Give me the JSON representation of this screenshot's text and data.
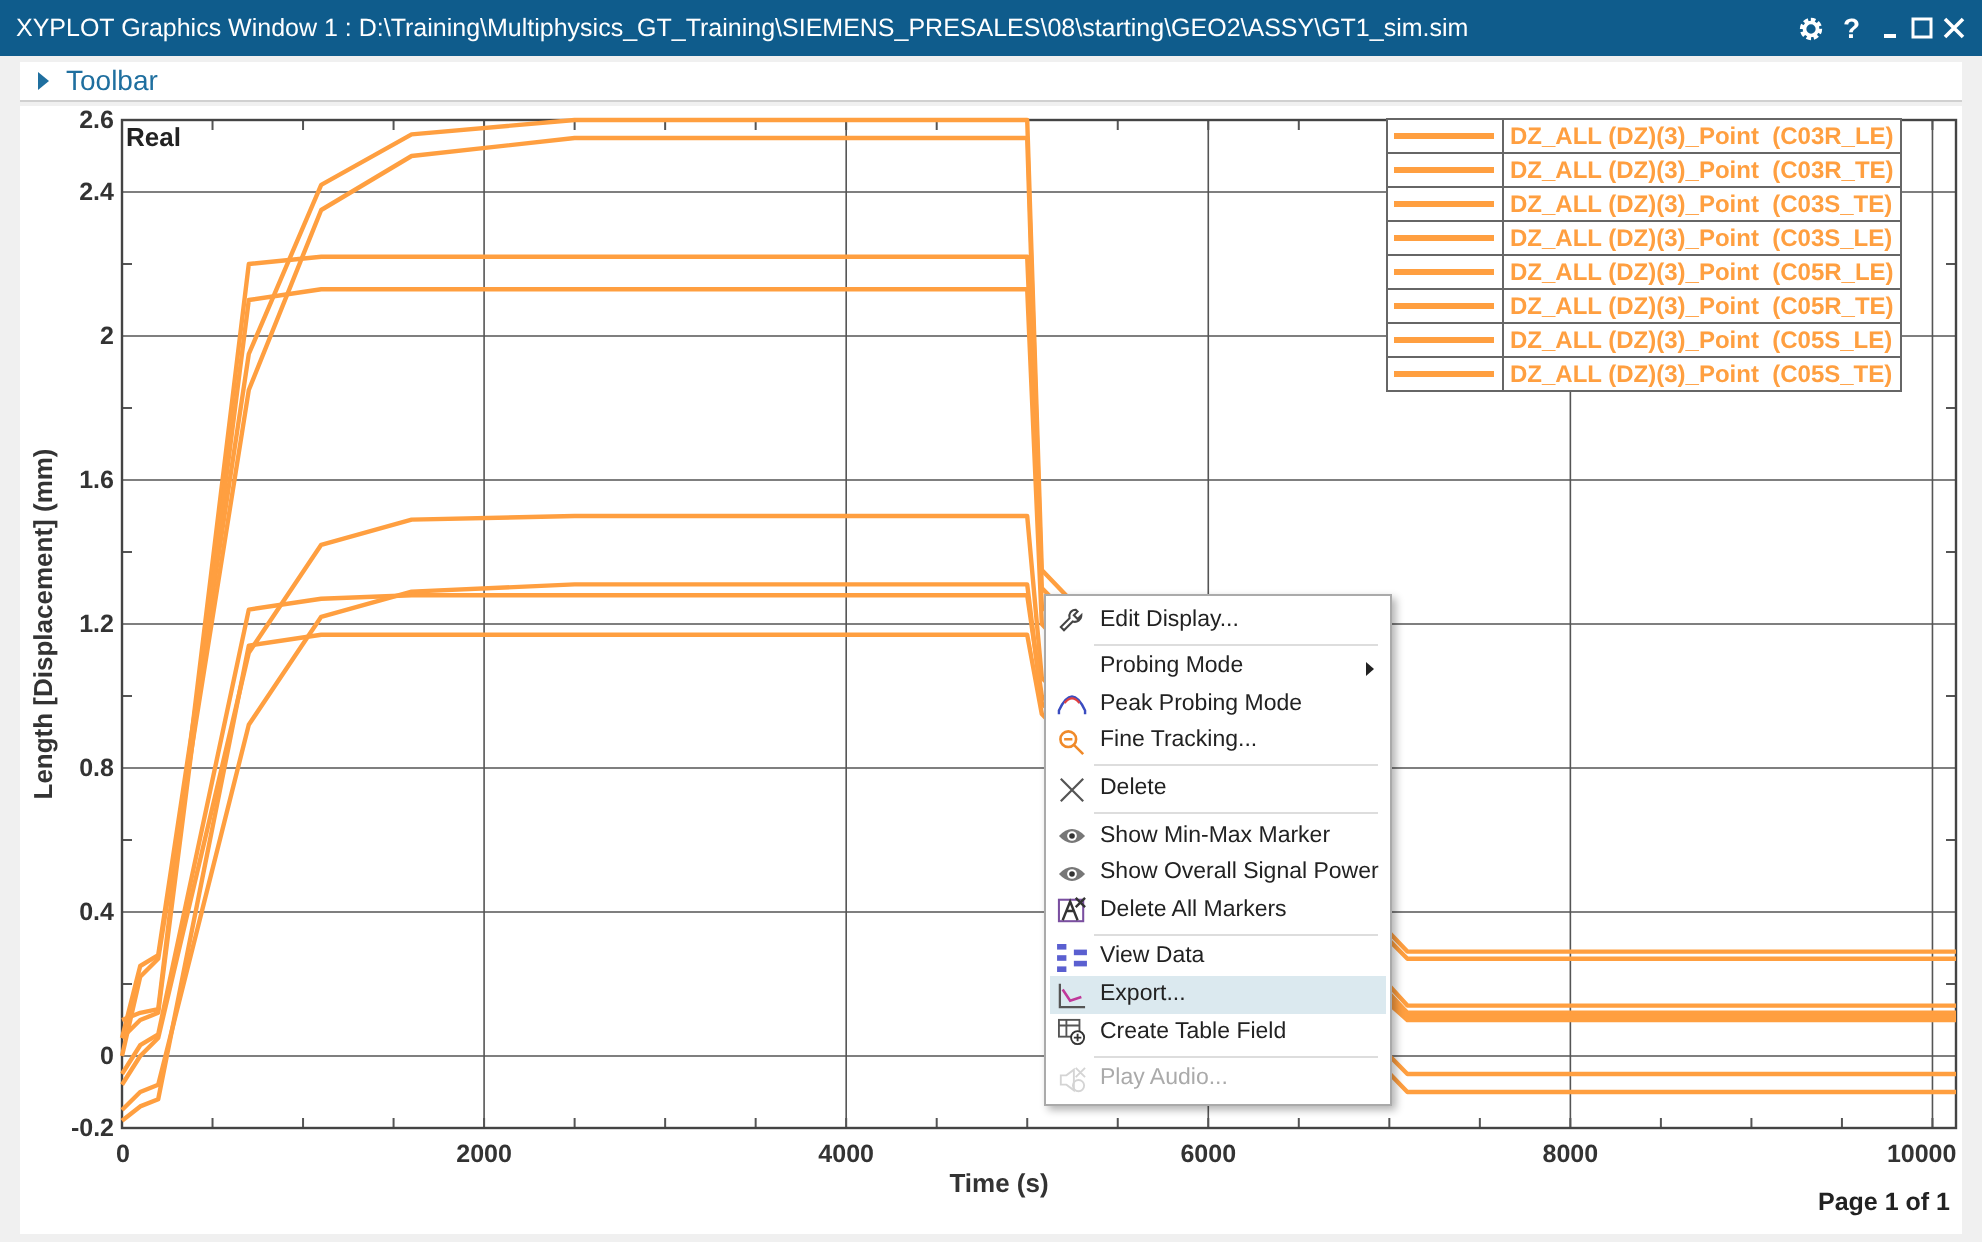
{
  "window": {
    "title": "XYPLOT Graphics Window 1 : D:\\Training\\Multiphysics_GT_Training\\SIEMENS_PRESALES\\08\\starting\\GEO2\\ASSY\\GT1_sim.sim",
    "help": "?"
  },
  "toolbar": {
    "label": "Toolbar",
    "expanded": false
  },
  "plot": {
    "corner_label": "Real",
    "page": "Page 1 of 1",
    "chart_data": {
      "type": "line",
      "xlabel": "Time (s)",
      "ylabel": "Length [Displacement] (mm)",
      "grid": true,
      "x": [
        0,
        100,
        200,
        700,
        1100,
        1600,
        2500,
        5000,
        5080,
        7100,
        10130
      ],
      "xlim": [
        0,
        10130
      ],
      "ylim": [
        -0.2,
        2.6
      ],
      "xticks": [
        0,
        2000,
        4000,
        6000,
        8000,
        10000
      ],
      "yticks": [
        -0.2,
        0,
        0.4,
        0.8,
        1.2,
        1.6,
        {
          "value": 2,
          "label": "2"
        },
        2.4,
        2.6
      ],
      "series": [
        {
          "name": "DZ_ALL (DZ)(3)_Point  (C03R_LE)",
          "color": "#ff9f40",
          "values": [
            0.05,
            0.25,
            0.28,
            1.95,
            2.42,
            2.56,
            2.6,
            2.6,
            1.35,
            0.29,
            0.29
          ]
        },
        {
          "name": "DZ_ALL (DZ)(3)_Point  (C03R_TE)",
          "color": "#ff9f40",
          "values": [
            0.0,
            0.22,
            0.27,
            1.85,
            2.35,
            2.5,
            2.55,
            2.55,
            1.3,
            0.27,
            0.27
          ]
        },
        {
          "name": "DZ_ALL (DZ)(3)_Point  (C03S_TE)",
          "color": "#ff9f40",
          "values": [
            0.1,
            0.12,
            0.13,
            2.2,
            2.22,
            2.22,
            2.22,
            2.22,
            1.25,
            0.14,
            0.14
          ]
        },
        {
          "name": "DZ_ALL (DZ)(3)_Point  (C03S_LE)",
          "color": "#ff9f40",
          "values": [
            0.05,
            0.1,
            0.12,
            2.1,
            2.13,
            2.13,
            2.13,
            2.13,
            1.2,
            0.12,
            0.12
          ]
        },
        {
          "name": "DZ_ALL (DZ)(3)_Point  (C05R_LE)",
          "color": "#ff9f40",
          "values": [
            -0.08,
            0.0,
            0.05,
            1.12,
            1.42,
            1.49,
            1.5,
            1.5,
            1.05,
            0.11,
            0.11
          ]
        },
        {
          "name": "DZ_ALL (DZ)(3)_Point  (C05R_TE)",
          "color": "#ff9f40",
          "values": [
            -0.05,
            0.03,
            0.06,
            1.24,
            1.27,
            1.28,
            1.28,
            1.28,
            1.0,
            0.1,
            0.1
          ]
        },
        {
          "name": "DZ_ALL (DZ)(3)_Point  (C05S_LE)",
          "color": "#ff9f40",
          "values": [
            -0.15,
            -0.1,
            -0.08,
            0.92,
            1.22,
            1.29,
            1.31,
            1.31,
            0.98,
            -0.05,
            -0.05
          ]
        },
        {
          "name": "DZ_ALL (DZ)(3)_Point  (C05S_TE)",
          "color": "#ff9f40",
          "values": [
            -0.18,
            -0.14,
            -0.12,
            1.14,
            1.17,
            1.17,
            1.17,
            1.17,
            0.95,
            -0.1,
            -0.1
          ]
        }
      ]
    }
  },
  "context_menu": {
    "groups": [
      [
        {
          "label": "Edit Display...",
          "selected": false,
          "disabled": false,
          "has_submenu": false
        }
      ],
      [
        {
          "label": "Probing Mode",
          "selected": false,
          "disabled": false,
          "has_submenu": true
        },
        {
          "label": "Peak Probing Mode",
          "selected": false,
          "disabled": false,
          "has_submenu": false
        },
        {
          "label": "Fine Tracking...",
          "selected": false,
          "disabled": false,
          "has_submenu": false
        }
      ],
      [
        {
          "label": "Delete",
          "selected": false,
          "disabled": false,
          "has_submenu": false
        }
      ],
      [
        {
          "label": "Show Min-Max Marker",
          "selected": false,
          "disabled": false,
          "has_submenu": false
        },
        {
          "label": "Show Overall Signal Power",
          "selected": false,
          "disabled": false,
          "has_submenu": false
        },
        {
          "label": "Delete All Markers",
          "selected": false,
          "disabled": false,
          "has_submenu": false
        }
      ],
      [
        {
          "label": "View Data",
          "selected": false,
          "disabled": false,
          "has_submenu": false
        },
        {
          "label": "Export...",
          "selected": true,
          "disabled": false,
          "has_submenu": false
        },
        {
          "label": "Create Table Field",
          "selected": false,
          "disabled": false,
          "has_submenu": false
        }
      ],
      [
        {
          "label": "Play Audio...",
          "selected": false,
          "disabled": true,
          "has_submenu": false
        }
      ]
    ]
  }
}
